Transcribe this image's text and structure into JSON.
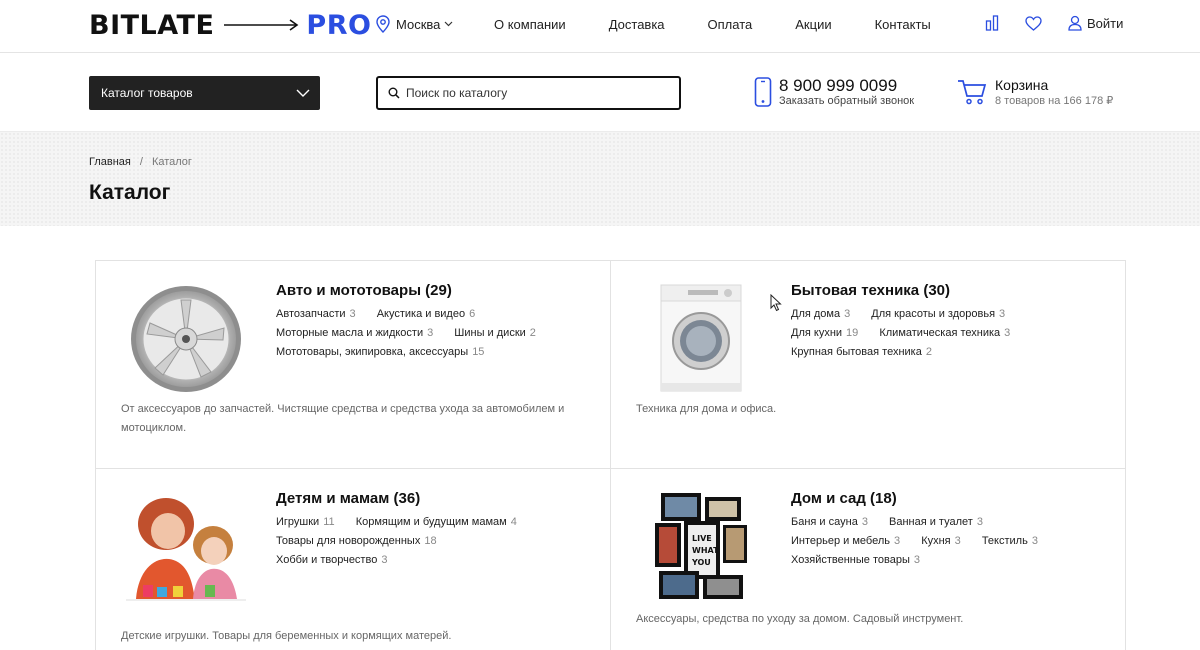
{
  "logo": {
    "left": "BITLATE",
    "right": "PRO"
  },
  "header": {
    "city": "Москва",
    "nav": [
      "О компании",
      "Доставка",
      "Оплата",
      "Акции",
      "Контакты"
    ],
    "login": "Войти"
  },
  "subheader": {
    "catalog_button": "Каталог товаров",
    "search_placeholder": "Поиск по каталогу",
    "phone": "8 900 999 0099",
    "callback": "Заказать обратный звонок",
    "cart_title": "Корзина",
    "cart_summary": "8 товаров на 166 178 ₽"
  },
  "breadcrumb": {
    "home": "Главная",
    "separator": "/",
    "current": "Каталог"
  },
  "page_title": "Каталог",
  "categories": [
    {
      "title": "Авто и мототовары (29)",
      "image": "car-wheel-icon",
      "subs": [
        {
          "label": "Автозапчасти",
          "count": "3"
        },
        {
          "label": "Акустика и видео",
          "count": "6"
        },
        {
          "label": "Моторные масла и жидкости",
          "count": "3"
        },
        {
          "label": "Шины и диски",
          "count": "2"
        },
        {
          "label": "Мототовары, экипировка, аксессуары",
          "count": "15"
        }
      ],
      "desc": "От аксессуаров до запчастей. Чистящие средства и средства ухода за автомобилем и мотоциклом."
    },
    {
      "title": "Бытовая техника (30)",
      "image": "washing-machine-icon",
      "subs": [
        {
          "label": "Для дома",
          "count": "3"
        },
        {
          "label": "Для красоты и здоровья",
          "count": "3"
        },
        {
          "label": "Для кухни",
          "count": "19"
        },
        {
          "label": "Климатическая техника",
          "count": "3"
        },
        {
          "label": "Крупная бытовая техника",
          "count": "2"
        }
      ],
      "desc": "Техника для дома и офиса."
    },
    {
      "title": "Детям и мамам (36)",
      "image": "mother-child-photo",
      "subs": [
        {
          "label": "Игрушки",
          "count": "11"
        },
        {
          "label": "Кормящим и будущим мамам",
          "count": "4"
        },
        {
          "label": "Товары для новорожденных",
          "count": "18"
        },
        {
          "label": "Хобби и творчество",
          "count": "3"
        }
      ],
      "desc": "Детские игрушки. Товары для беременных и кормящих матерей."
    },
    {
      "title": "Дом и сад (18)",
      "image": "photo-frames-icon",
      "subs": [
        {
          "label": "Баня и сауна",
          "count": "3"
        },
        {
          "label": "Ванная и туалет",
          "count": "3"
        },
        {
          "label": "Интерьер и мебель",
          "count": "3"
        },
        {
          "label": "Кухня",
          "count": "3"
        },
        {
          "label": "Текстиль",
          "count": "3"
        },
        {
          "label": "Хозяйственные товары",
          "count": "3"
        }
      ],
      "desc": "Аксессуары, средства по уходу за домом. Садовый инструмент."
    }
  ],
  "colors": {
    "accent": "#2b4ee0",
    "dark": "#222222"
  }
}
